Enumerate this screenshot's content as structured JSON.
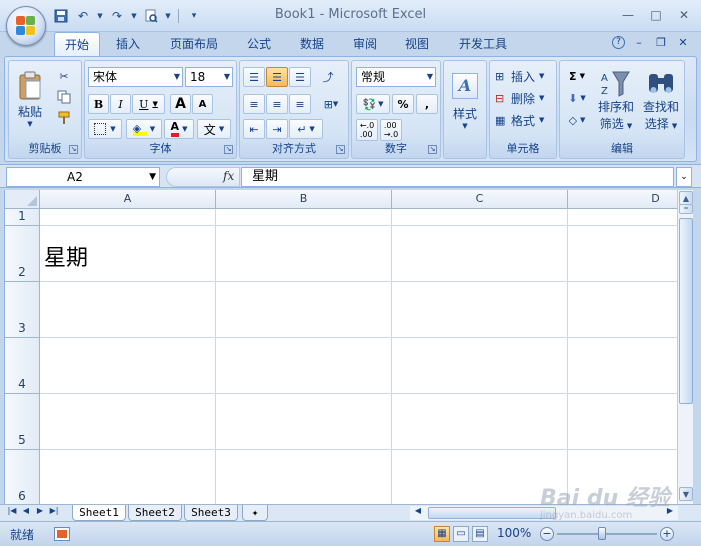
{
  "window": {
    "title": "Book1 - Microsoft Excel",
    "minimize": "—",
    "maximize": "□",
    "close": "✕"
  },
  "quick_access": {
    "save_icon": "save-icon",
    "undo_icon": "undo-icon",
    "redo_icon": "redo-icon",
    "print_preview_icon": "print-preview-icon"
  },
  "ribbon_tabs": [
    "开始",
    "插入",
    "页面布局",
    "公式",
    "数据",
    "审阅",
    "视图",
    "开发工具"
  ],
  "active_tab": "开始",
  "ribbon_controls": {
    "help": "?",
    "minimize": "–",
    "restore": "❐",
    "close": "✕"
  },
  "groups": {
    "clipboard": {
      "label": "剪贴板",
      "paste": "粘贴"
    },
    "font": {
      "label": "字体",
      "font_name": "宋体",
      "font_size": "18",
      "bold": "B",
      "italic": "I",
      "underline": "U",
      "grow": "A",
      "shrink": "A",
      "phonetic": "文"
    },
    "alignment": {
      "label": "对齐方式"
    },
    "number": {
      "label": "数字",
      "format": "常规",
      "percent": "%",
      "comma": ",",
      "inc_decimal": ".0\n.00",
      "dec_decimal": ".00\n.0"
    },
    "styles": {
      "label": "样式"
    },
    "cells": {
      "label": "单元格",
      "insert": "插入",
      "delete": "删除",
      "format": "格式"
    },
    "editing": {
      "label": "编辑",
      "sum": "Σ",
      "sort_filter_1": "排序和",
      "sort_filter_2": "筛选",
      "find_select_1": "查找和",
      "find_select_2": "选择"
    }
  },
  "formula_bar": {
    "name_box": "A2",
    "fx": "fx",
    "content": "星期"
  },
  "columns": [
    "A",
    "B",
    "C",
    "D"
  ],
  "rows": [
    "1",
    "2",
    "3",
    "4",
    "5",
    "6"
  ],
  "cells": {
    "A2": "星期"
  },
  "sheets": [
    "Sheet1",
    "Sheet2",
    "Sheet3"
  ],
  "active_sheet": "Sheet1",
  "status": {
    "mode": "就绪",
    "zoom": "100%",
    "zoom_out": "−",
    "zoom_in": "+"
  },
  "watermark": {
    "line1": "Bai du 经验",
    "line2": "jingyan.baidu.com"
  },
  "colors": {
    "ribbon": "#dce8f6",
    "accent": "#15428b",
    "grid_line": "#d0d7e5",
    "header": "#e1eaf6"
  }
}
